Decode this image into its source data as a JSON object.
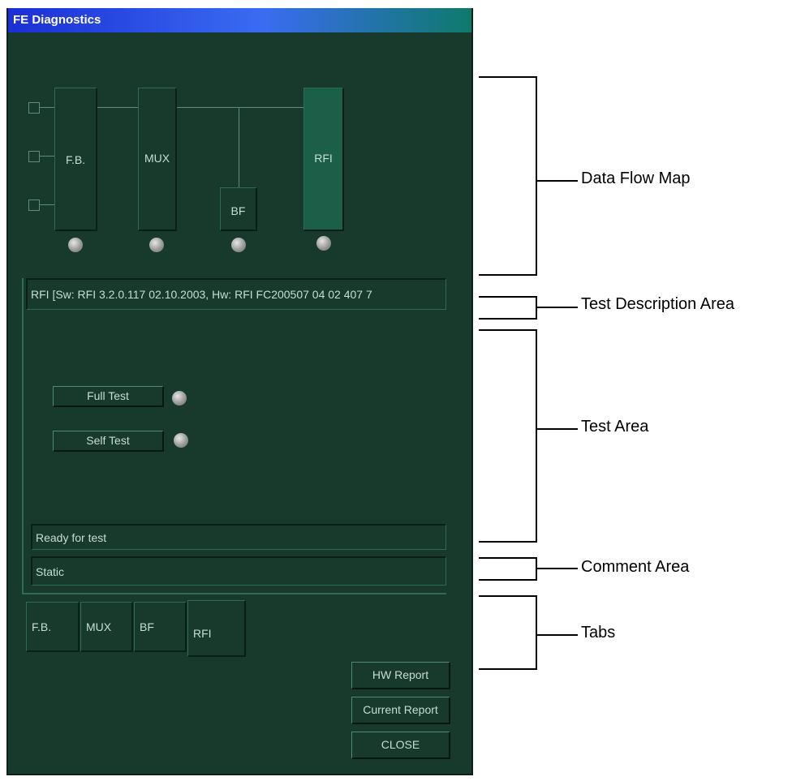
{
  "window": {
    "title": "FE Diagnostics"
  },
  "flow_map": {
    "modules": [
      {
        "id": "fb",
        "label": "F.B."
      },
      {
        "id": "mux",
        "label": "MUX"
      },
      {
        "id": "bf",
        "label": "BF"
      },
      {
        "id": "rfi",
        "label": "RFI",
        "selected": true
      }
    ]
  },
  "description": {
    "text": "RFI [Sw: RFI 3.2.0.117 02.10.2003, Hw: RFI FC200507 04 02 407 7"
  },
  "tests": {
    "full_test_label": "Full Test",
    "self_test_label": "Self Test"
  },
  "status": {
    "text": "Ready for test"
  },
  "comment": {
    "text": "Static"
  },
  "tabs": [
    {
      "label": "F.B."
    },
    {
      "label": "MUX"
    },
    {
      "label": "BF"
    },
    {
      "label": "RFI"
    }
  ],
  "buttons": {
    "hw_report": "HW Report",
    "current_report": "Current Report",
    "close": "CLOSE"
  },
  "annotations": {
    "data_flow_map": "Data Flow Map",
    "test_description_area": "Test Description Area",
    "test_area": "Test Area",
    "comment_area": "Comment Area",
    "tabs": "Tabs"
  },
  "colors": {
    "window_bg": "#173a2d",
    "selected_module": "#1b5f48",
    "title_start": "#1b2fd6",
    "text": "#c8ddd3"
  }
}
